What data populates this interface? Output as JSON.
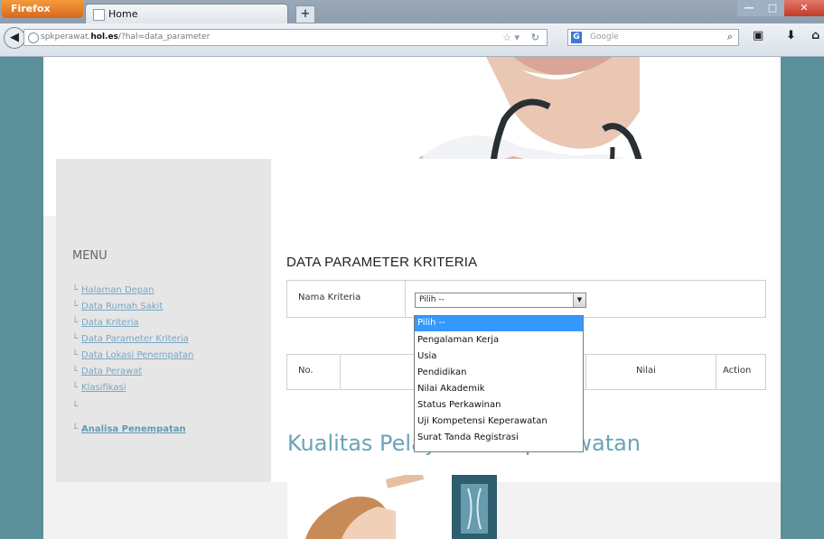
{
  "browser": {
    "menu_button": "Firefox",
    "tab_title": "Home",
    "new_tab": "+",
    "url_prefix": "spkperawat.",
    "url_domain": "hol.es",
    "url_path": "/?hal=data_parameter",
    "search_placeholder": "Google",
    "search_engine": "G",
    "window_controls": {
      "minimize": "—",
      "maximize": "□",
      "close": "✕"
    }
  },
  "sidebar": {
    "title": "MENU",
    "items": [
      {
        "label": "Halaman Depan",
        "branch": "└"
      },
      {
        "label": "Data Rumah Sakit",
        "branch": "└"
      },
      {
        "label": "Data Kriteria",
        "branch": "└"
      },
      {
        "label": "Data Parameter Kriteria",
        "branch": "└"
      },
      {
        "label": "Data Lokasi Penempatan",
        "branch": "└"
      },
      {
        "label": "Data Perawat",
        "branch": "└"
      },
      {
        "label": "Klasifikasi",
        "branch": "└"
      },
      {
        "label": "",
        "branch": "└"
      },
      {
        "label": "Analisa Penempatan",
        "branch": "└"
      }
    ]
  },
  "main": {
    "title": "DATA PARAMETER KRITERIA",
    "filter_label": "Nama Kriteria",
    "select_value": "Pilih --",
    "table_headers": [
      "No.",
      "Nilai",
      "Action"
    ],
    "dropdown_options": [
      "Pilih --",
      "Pengalaman Kerja",
      "Usia",
      "Pendidikan",
      "Nilai Akademik",
      "Status Perkawinan",
      "Uji Kompetensi Keperawatan",
      "Surat Tanda Registrasi"
    ],
    "selected_option_index": 0,
    "quality_heading": "Kualitas Pelayanan Keperawatan"
  },
  "colors": {
    "accent_teal": "#5b8f9a",
    "link": "#7aa6c4",
    "highlight": "#3399ff",
    "heading_teal": "#6aa3b8"
  }
}
